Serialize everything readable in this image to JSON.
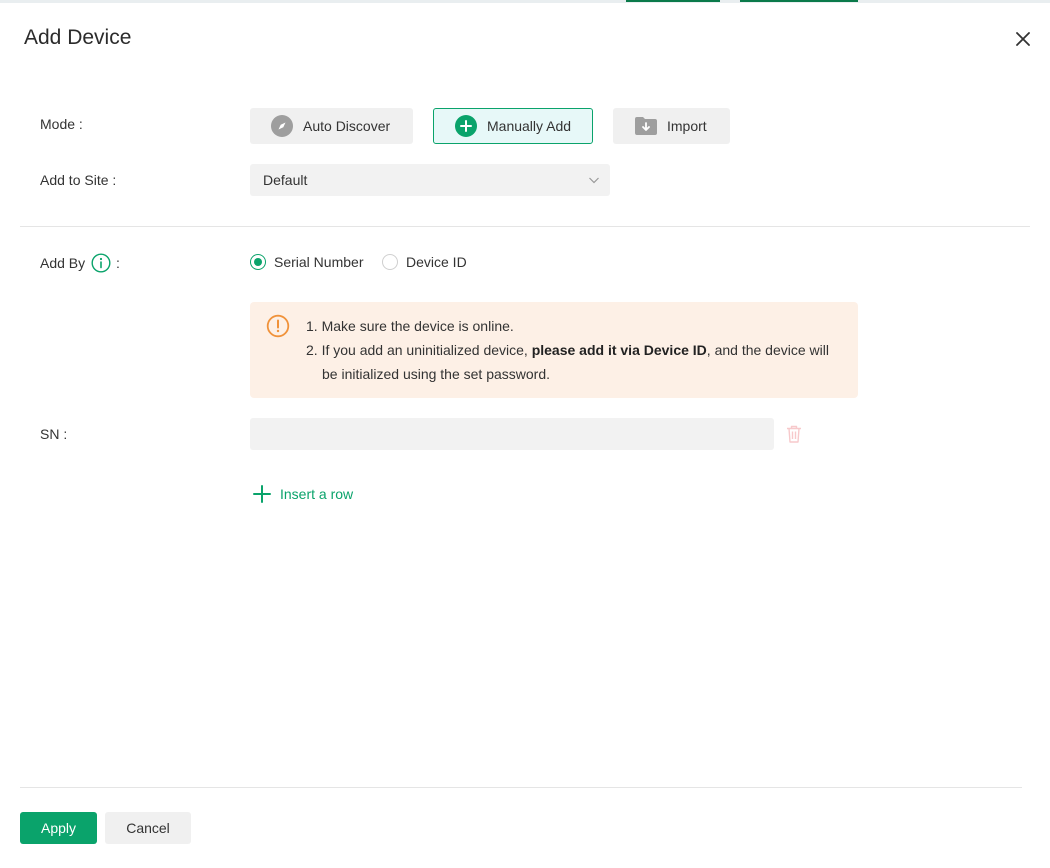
{
  "dialog": {
    "title": "Add Device"
  },
  "mode": {
    "label": "Mode :",
    "options": [
      {
        "label": "Auto Discover",
        "icon": "compass-icon",
        "selected": false
      },
      {
        "label": "Manually Add",
        "icon": "plus-circle-icon",
        "selected": true
      },
      {
        "label": "Import",
        "icon": "folder-download-icon",
        "selected": false
      }
    ]
  },
  "site": {
    "label": "Add to Site :",
    "selected": "Default"
  },
  "add_by": {
    "label": "Add By",
    "colon": ":",
    "options": [
      {
        "label": "Serial Number",
        "selected": true
      },
      {
        "label": "Device ID",
        "selected": false
      }
    ]
  },
  "notice": {
    "item1": "1. Make sure the device is online.",
    "item2_prefix": "2. If you add an uninitialized device, ",
    "item2_bold": "please add it via Device ID",
    "item2_suffix": ", and the device will",
    "item2_cont": "be initialized using the set password."
  },
  "sn": {
    "label": "SN :",
    "value": ""
  },
  "insert_row": {
    "label": "Insert a row"
  },
  "footer": {
    "apply_label": "Apply",
    "cancel_label": "Cancel"
  },
  "colors": {
    "accent": "#0aa36b",
    "notice_bg": "#fdf0e6",
    "warning": "#f0923a",
    "trash": "#f7c9cb"
  }
}
